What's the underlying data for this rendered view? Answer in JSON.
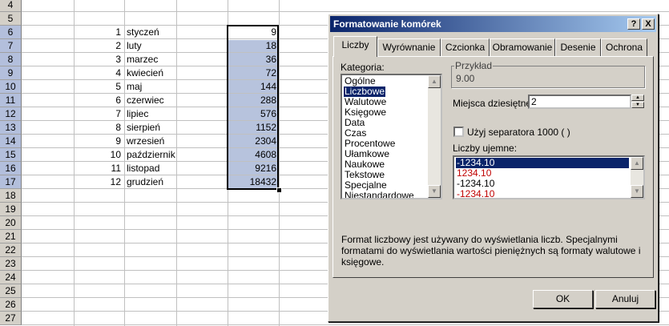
{
  "sheet": {
    "row_numbers": [
      "4",
      "5",
      "6",
      "7",
      "8",
      "9",
      "10",
      "11",
      "12",
      "13",
      "14",
      "15",
      "16",
      "17",
      "18",
      "19",
      "20",
      "21",
      "22",
      "23",
      "24",
      "25",
      "26",
      "27"
    ],
    "rows": [
      {
        "idx": "1",
        "month": "styczeń",
        "value": "9"
      },
      {
        "idx": "2",
        "month": "luty",
        "value": "18"
      },
      {
        "idx": "3",
        "month": "marzec",
        "value": "36"
      },
      {
        "idx": "4",
        "month": "kwiecień",
        "value": "72"
      },
      {
        "idx": "5",
        "month": "maj",
        "value": "144"
      },
      {
        "idx": "6",
        "month": "czerwiec",
        "value": "288"
      },
      {
        "idx": "7",
        "month": "lipiec",
        "value": "576"
      },
      {
        "idx": "8",
        "month": "sierpień",
        "value": "1152"
      },
      {
        "idx": "9",
        "month": "wrzesień",
        "value": "2304"
      },
      {
        "idx": "10",
        "month": "październik",
        "value": "4608"
      },
      {
        "idx": "11",
        "month": "listopad",
        "value": "9216"
      },
      {
        "idx": "12",
        "month": "grudzień",
        "value": "18432"
      }
    ],
    "selection_color": "#b7c3dd"
  },
  "dialog": {
    "title": "Formatowanie komórek",
    "help_button": "?",
    "close_button": "X",
    "tabs": [
      "Liczby",
      "Wyrównanie",
      "Czcionka",
      "Obramowanie",
      "Desenie",
      "Ochrona"
    ],
    "category_label": "Kategoria:",
    "categories": [
      "Ogólne",
      "Liczbowe",
      "Walutowe",
      "Księgowe",
      "Data",
      "Czas",
      "Procentowe",
      "Ułamkowe",
      "Naukowe",
      "Tekstowe",
      "Specjalne",
      "Niestandardowe"
    ],
    "selected_category": "Liczbowe",
    "sample_label": "Przykład",
    "sample_value": "9.00",
    "decimals_label": "Miejsca dziesiętne:",
    "decimals_value": "2",
    "separator_label": "Użyj separatora 1000 ( )",
    "negatives_label": "Liczby ujemne:",
    "negatives": [
      {
        "text": "-1234.10",
        "style": "selected"
      },
      {
        "text": "1234.10",
        "style": "red"
      },
      {
        "text": "-1234.10",
        "style": "normal"
      },
      {
        "text": "-1234.10",
        "style": "red"
      }
    ],
    "description": "Format liczbowy jest używany do wyświetlania liczb. Specjalnymi formatami do wyświetlania wartości pieniężnych są formaty walutowe i księgowe.",
    "ok_label": "OK",
    "cancel_label": "Anuluj",
    "title_color": "#0a246a",
    "negative_red": "#c00000"
  }
}
